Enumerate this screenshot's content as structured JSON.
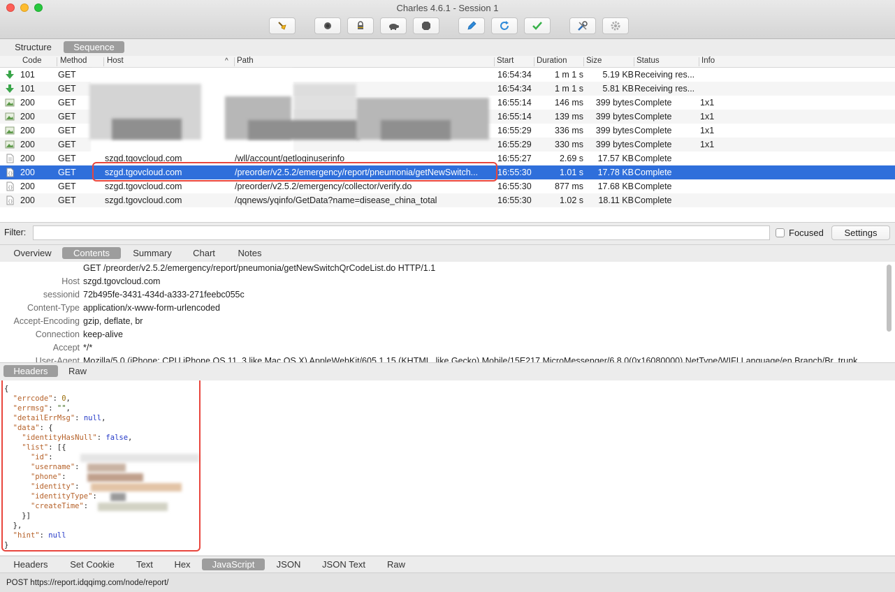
{
  "window": {
    "title": "Charles 4.6.1 - Session 1"
  },
  "toolbar": {
    "buttons": [
      {
        "name": "broom-icon"
      },
      {
        "name": "record-icon"
      },
      {
        "name": "lock-icon"
      },
      {
        "name": "turtle-icon"
      },
      {
        "name": "stop-icon"
      },
      {
        "name": "pen-icon"
      },
      {
        "name": "refresh-icon"
      },
      {
        "name": "checkmark-icon"
      },
      {
        "name": "tools-icon"
      },
      {
        "name": "gear-icon"
      }
    ]
  },
  "view_tabs": {
    "structure": "Structure",
    "sequence": "Sequence",
    "active": "Sequence"
  },
  "table": {
    "columns": {
      "code": "Code",
      "method": "Method",
      "host": "Host",
      "path": "Path",
      "start": "Start",
      "duration": "Duration",
      "size": "Size",
      "status": "Status",
      "info": "Info"
    },
    "rows": [
      {
        "icon": "download-arrow-icon",
        "code": "101",
        "method": "GET",
        "host": "",
        "path": "",
        "start": "16:54:34",
        "duration": "1 m 1 s",
        "size": "5.19 KB",
        "status": "Receiving res...",
        "info": ""
      },
      {
        "icon": "download-arrow-icon",
        "code": "101",
        "method": "GET",
        "host": "",
        "path": "",
        "start": "16:54:34",
        "duration": "1 m 1 s",
        "size": "5.81 KB",
        "status": "Receiving res...",
        "info": ""
      },
      {
        "icon": "image-file-icon",
        "code": "200",
        "method": "GET",
        "host": "",
        "path": "",
        "start": "16:55:14",
        "duration": "146 ms",
        "size": "399 bytes",
        "status": "Complete",
        "info": "1x1"
      },
      {
        "icon": "image-file-icon",
        "code": "200",
        "method": "GET",
        "host": "",
        "path": "",
        "start": "16:55:14",
        "duration": "139 ms",
        "size": "399 bytes",
        "status": "Complete",
        "info": "1x1"
      },
      {
        "icon": "image-file-icon",
        "code": "200",
        "method": "GET",
        "host": "",
        "path": "",
        "start": "16:55:29",
        "duration": "336 ms",
        "size": "399 bytes",
        "status": "Complete",
        "info": "1x1"
      },
      {
        "icon": "image-file-icon",
        "code": "200",
        "method": "GET",
        "host": "",
        "path": "",
        "start": "16:55:29",
        "duration": "330 ms",
        "size": "399 bytes",
        "status": "Complete",
        "info": "1x1"
      },
      {
        "icon": "document-icon",
        "code": "200",
        "method": "GET",
        "host": "szgd.tgovcloud.com",
        "path": "/wll/account/getloginuserinfo",
        "start": "16:55:27",
        "duration": "2.69 s",
        "size": "17.57 KB",
        "status": "Complete",
        "info": ""
      },
      {
        "icon": "json-file-icon",
        "code": "200",
        "method": "GET",
        "host": "szgd.tgovcloud.com",
        "path": "/preorder/v2.5.2/emergency/report/pneumonia/getNewSwitch...",
        "start": "16:55:30",
        "duration": "1.01 s",
        "size": "17.78 KB",
        "status": "Complete",
        "info": ""
      },
      {
        "icon": "json-file-icon",
        "code": "200",
        "method": "GET",
        "host": "szgd.tgovcloud.com",
        "path": "/preorder/v2.5.2/emergency/collector/verify.do",
        "start": "16:55:30",
        "duration": "877 ms",
        "size": "17.68 KB",
        "status": "Complete",
        "info": ""
      },
      {
        "icon": "json-file-icon",
        "code": "200",
        "method": "GET",
        "host": "szgd.tgovcloud.com",
        "path": "/qqnews/yqinfo/GetData?name=disease_china_total",
        "start": "16:55:30",
        "duration": "1.02 s",
        "size": "18.11 KB",
        "status": "Complete",
        "info": ""
      }
    ]
  },
  "filter": {
    "label": "Filter:",
    "value": "",
    "focused_label": "Focused",
    "settings_label": "Settings"
  },
  "detail_tabs": {
    "items": [
      "Overview",
      "Contents",
      "Summary",
      "Chart",
      "Notes"
    ],
    "active": "Contents"
  },
  "request": {
    "request_line": "GET /preorder/v2.5.2/emergency/report/pneumonia/getNewSwitchQrCodeList.do HTTP/1.1",
    "headers": [
      {
        "key": "Host",
        "value": "szgd.tgovcloud.com"
      },
      {
        "key": "sessionid",
        "value": "72b495fe-3431-434d-a333-271feebc055c"
      },
      {
        "key": "Content-Type",
        "value": "application/x-www-form-urlencoded"
      },
      {
        "key": "Accept-Encoding",
        "value": "gzip, deflate, br"
      },
      {
        "key": "Connection",
        "value": "keep-alive"
      },
      {
        "key": "Accept",
        "value": "*/*"
      },
      {
        "key": "User-Agent",
        "value": "Mozilla/5.0 (iPhone; CPU iPhone OS 11_3 like Mac OS X) AppleWebKit/605.1.15 (KHTML, like Gecko) Mobile/15E217 MicroMessenger/6.8.0(0x16080000) NetType/WIFI Language/en Branch/Br_trunk"
      }
    ]
  },
  "request_tabs": {
    "items": [
      "Headers",
      "Raw"
    ],
    "active": "Headers"
  },
  "response_body": {
    "lines": [
      "{",
      "  \"errcode\": 0,",
      "  \"errmsg\": \"\",",
      "  \"detailErrMsg\": null,",
      "  \"data\": {",
      "    \"identityHasNull\": false,",
      "    \"list\": [{",
      "      \"id\": ",
      "      \"username\": ",
      "      \"phone\": ",
      "      \"identity\": ",
      "      \"identityType\": ",
      "      \"createTime\": ",
      "    }]",
      "  },",
      "  \"hint\": null",
      "}"
    ]
  },
  "response_tabs": {
    "items": [
      "Headers",
      "Set Cookie",
      "Text",
      "Hex",
      "JavaScript",
      "JSON",
      "JSON Text",
      "Raw"
    ],
    "active": "JavaScript"
  },
  "status_bar": {
    "text": "POST https://report.idqqimg.com/node/report/"
  },
  "colors": {
    "selection": "#2f6fdb",
    "highlight_box": "#e8463d",
    "active_pill": "#9d9d9d"
  }
}
